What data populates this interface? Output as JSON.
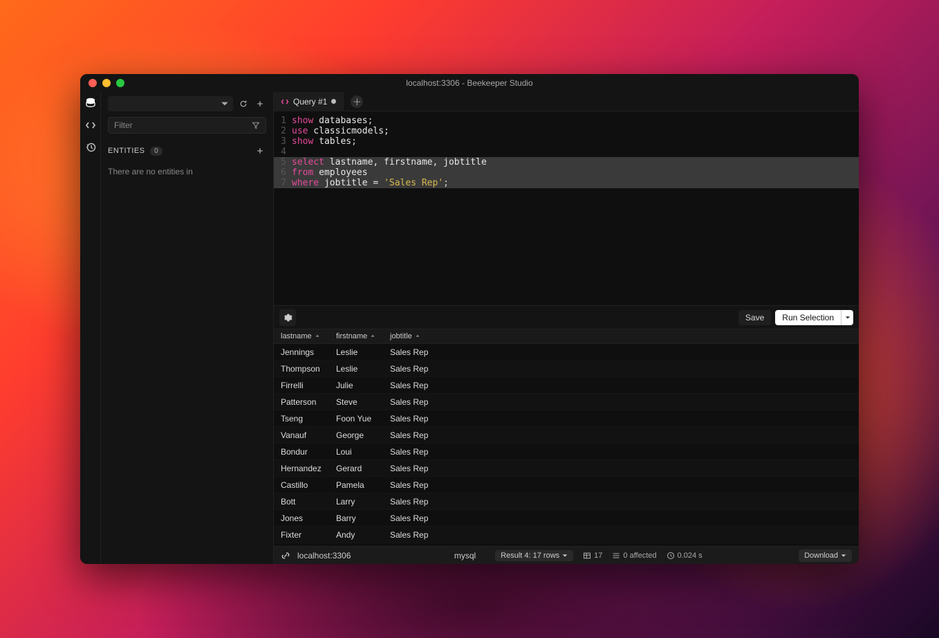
{
  "window": {
    "title": "localhost:3306 - Beekeeper Studio"
  },
  "sidebar": {
    "filter_placeholder": "Filter",
    "entities_label": "ENTITIES",
    "entities_count": "0",
    "empty_text": "There are no entities in"
  },
  "tabs": {
    "active_label": "Query #1"
  },
  "editor": {
    "lines": [
      {
        "n": "1",
        "hl": false,
        "segs": [
          {
            "t": "show",
            "c": "kw"
          },
          {
            "t": " ",
            "c": "punct"
          },
          {
            "t": "databases",
            "c": "ident"
          },
          {
            "t": ";",
            "c": "punct"
          }
        ]
      },
      {
        "n": "2",
        "hl": false,
        "segs": [
          {
            "t": "use",
            "c": "kw"
          },
          {
            "t": " classicmodels;",
            "c": "ident"
          }
        ]
      },
      {
        "n": "3",
        "hl": false,
        "segs": [
          {
            "t": "show",
            "c": "kw"
          },
          {
            "t": " ",
            "c": "punct"
          },
          {
            "t": "tables",
            "c": "ident"
          },
          {
            "t": ";",
            "c": "punct"
          }
        ]
      },
      {
        "n": "4",
        "hl": false,
        "segs": []
      },
      {
        "n": "5",
        "hl": true,
        "segs": [
          {
            "t": "select",
            "c": "kw"
          },
          {
            "t": " lastname, firstname, jobtitle",
            "c": "ident"
          }
        ]
      },
      {
        "n": "6",
        "hl": true,
        "segs": [
          {
            "t": "from",
            "c": "kw"
          },
          {
            "t": " employees",
            "c": "ident"
          }
        ]
      },
      {
        "n": "7",
        "hl": true,
        "segs": [
          {
            "t": "where",
            "c": "kw"
          },
          {
            "t": " jobtitle = ",
            "c": "ident"
          },
          {
            "t": "'Sales Rep'",
            "c": "str"
          },
          {
            "t": ";",
            "c": "punct"
          }
        ]
      }
    ]
  },
  "actions": {
    "save": "Save",
    "run_selection": "Run Selection"
  },
  "results": {
    "columns": [
      "lastname",
      "firstname",
      "jobtitle"
    ],
    "rows": [
      {
        "lastname": "Jennings",
        "firstname": "Leslie",
        "jobtitle": "Sales Rep"
      },
      {
        "lastname": "Thompson",
        "firstname": "Leslie",
        "jobtitle": "Sales Rep"
      },
      {
        "lastname": "Firrelli",
        "firstname": "Julie",
        "jobtitle": "Sales Rep"
      },
      {
        "lastname": "Patterson",
        "firstname": "Steve",
        "jobtitle": "Sales Rep"
      },
      {
        "lastname": "Tseng",
        "firstname": "Foon Yue",
        "jobtitle": "Sales Rep"
      },
      {
        "lastname": "Vanauf",
        "firstname": "George",
        "jobtitle": "Sales Rep"
      },
      {
        "lastname": "Bondur",
        "firstname": "Loui",
        "jobtitle": "Sales Rep"
      },
      {
        "lastname": "Hernandez",
        "firstname": "Gerard",
        "jobtitle": "Sales Rep"
      },
      {
        "lastname": "Castillo",
        "firstname": "Pamela",
        "jobtitle": "Sales Rep"
      },
      {
        "lastname": "Bott",
        "firstname": "Larry",
        "jobtitle": "Sales Rep"
      },
      {
        "lastname": "Jones",
        "firstname": "Barry",
        "jobtitle": "Sales Rep"
      },
      {
        "lastname": "Fixter",
        "firstname": "Andy",
        "jobtitle": "Sales Rep"
      }
    ]
  },
  "status": {
    "connection": "localhost:3306",
    "db_type": "mysql",
    "result_label": "Result 4: 17 rows",
    "row_count": "17",
    "affected": "0 affected",
    "time": "0.024 s",
    "download": "Download"
  }
}
